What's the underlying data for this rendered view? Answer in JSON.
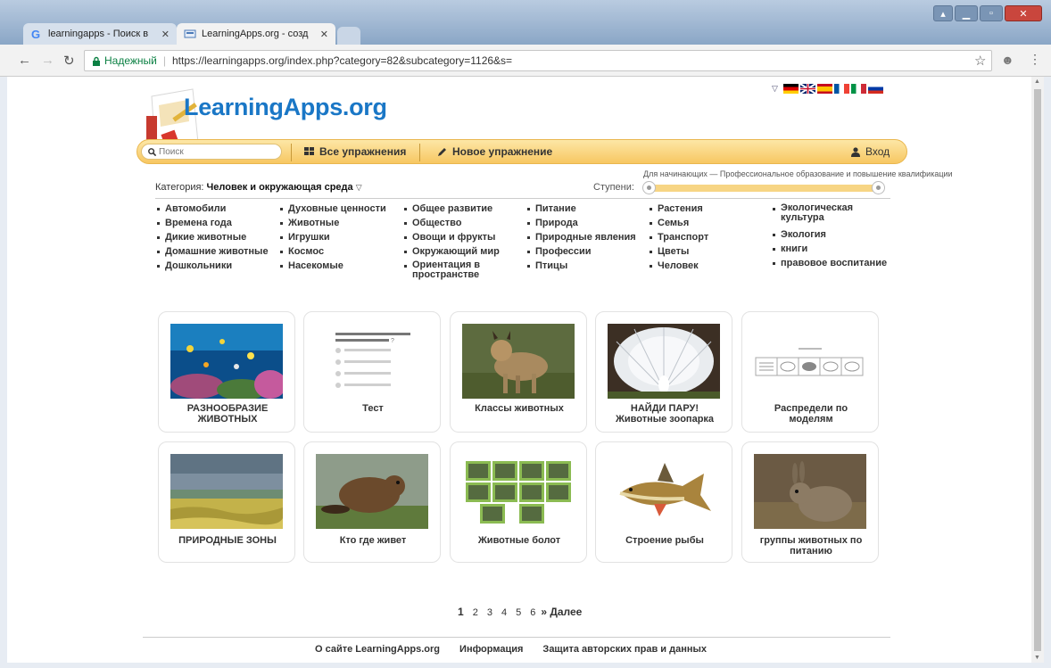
{
  "browser": {
    "tabs": [
      {
        "title": "learningapps - Поиск в ",
        "close": "✕"
      },
      {
        "title": "LearningApps.org - созд",
        "close": "✕"
      }
    ],
    "secure_label": "Надежный",
    "url": "https://learningapps.org/index.php?category=82&subcategory=1126&s="
  },
  "logo": {
    "text": "LearningApps.org"
  },
  "toolbar": {
    "search_placeholder": "Поиск",
    "all_exercises": "Все упражнения",
    "new_exercise": "Новое упражнение",
    "login": "Вход"
  },
  "levels": {
    "caption": "Для начинающих — Профессиональное образование и повышение квалификации",
    "label": "Ступени:"
  },
  "category": {
    "prefix": "Категория:",
    "value": "Человек и окружающая среда"
  },
  "subcategories": [
    [
      "Автомобили",
      "Времена года",
      "Дикие животные",
      "Домашние животные",
      "Дошкольники"
    ],
    [
      "Духовные ценности",
      "Животные",
      "Игрушки",
      "Космос",
      "Насекомые"
    ],
    [
      "Общее развитие",
      "Общество",
      "Овощи и фрукты",
      "Окружающий мир",
      "Ориентация в пространстве"
    ],
    [
      "Питание",
      "Природа",
      "Природные явления",
      "Профессии",
      "Птицы"
    ],
    [
      "Растения",
      "Семья",
      "Транспорт",
      "Цветы",
      "Человек"
    ],
    [
      "Экологическая культура",
      "Экология",
      "книги",
      "правовое воспитание"
    ]
  ],
  "cards": [
    {
      "l1": "РАЗНООБРАЗИЕ",
      "l2": "ЖИВОТНЫХ"
    },
    {
      "l1": "Тест",
      "l2": ""
    },
    {
      "l1": "Классы животных",
      "l2": ""
    },
    {
      "l1": "НАЙДИ ПАРУ!",
      "l2": "Животные зоопарка"
    },
    {
      "l1": "Распредели по",
      "l2": "моделям"
    },
    {
      "l1": "ПРИРОДНЫЕ ЗОНЫ",
      "l2": ""
    },
    {
      "l1": "Кто где живет",
      "l2": ""
    },
    {
      "l1": "Животные болот",
      "l2": ""
    },
    {
      "l1": "Строение рыбы",
      "l2": ""
    },
    {
      "l1": "группы животных по",
      "l2": "питанию"
    }
  ],
  "pager": {
    "pages": [
      "1",
      "2",
      "3",
      "4",
      "5",
      "6"
    ],
    "next": "» Далее"
  },
  "footer": [
    "О сайте LearningApps.org",
    "Информация",
    "Защита авторских прав и данных"
  ]
}
